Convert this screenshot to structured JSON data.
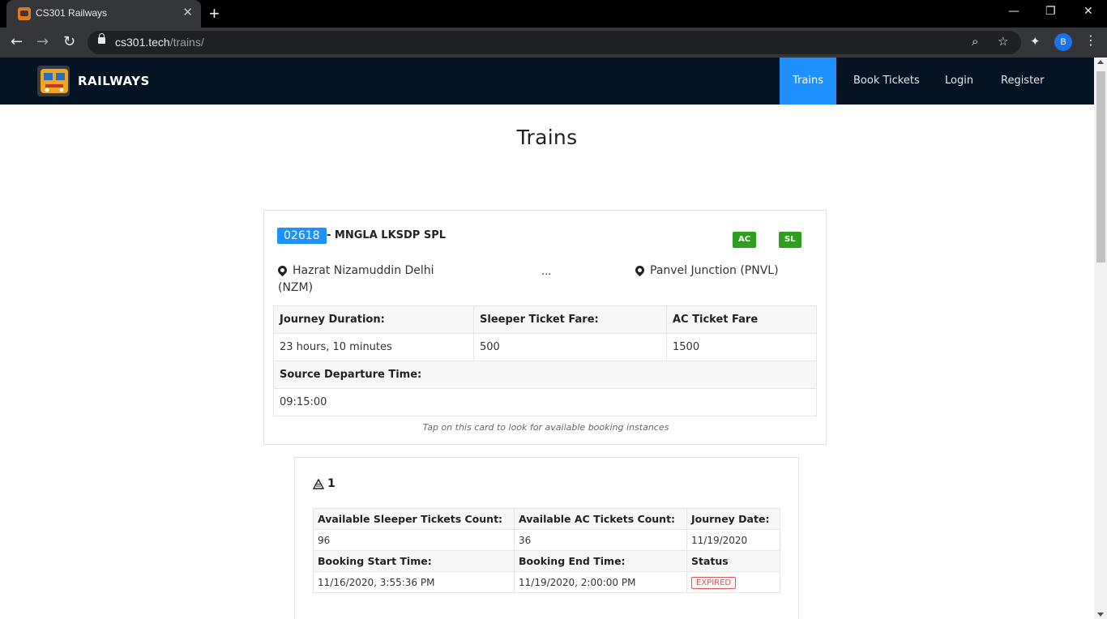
{
  "browser": {
    "tab_title": "CS301 Railways",
    "url_domain": "cs301.tech",
    "url_path": "/trains/",
    "profile_initial": "B"
  },
  "navbar": {
    "brand": "RAILWAYS",
    "links": [
      "Trains",
      "Book Tickets",
      "Login",
      "Register"
    ],
    "active": "Trains"
  },
  "page": {
    "title": "Trains"
  },
  "train": {
    "number": "02618",
    "name": "- MNGLA LKSDP SPL",
    "classes": [
      "AC",
      "SL"
    ],
    "source": "Hazrat Nizamuddin Delhi (NZM)",
    "source_line1": "Hazrat Nizamuddin Delhi",
    "source_line2": "(NZM)",
    "separator": "...",
    "destination": "Panvel Junction (PNVL)",
    "labels": {
      "duration": "Journey Duration:",
      "sleeper_fare": "Sleeper Ticket Fare:",
      "ac_fare": "AC Ticket Fare",
      "departure": "Source Departure Time:"
    },
    "duration": "23 hours, 10 minutes",
    "sleeper_fare": "500",
    "ac_fare": "1500",
    "departure_time": "09:15:00",
    "hint": "Tap on this card to look for available booking instances"
  },
  "instance": {
    "id": "1",
    "labels": {
      "sleeper_count": "Available Sleeper Tickets Count:",
      "ac_count": "Available AC Tickets Count:",
      "journey_date": "Journey Date:",
      "booking_start": "Booking Start Time:",
      "booking_end": "Booking End Time:",
      "status": "Status"
    },
    "sleeper_count": "96",
    "ac_count": "36",
    "journey_date": "11/19/2020",
    "booking_start": "11/16/2020, 3:55:36 PM",
    "booking_end": "11/19/2020, 2:00:00 PM",
    "status": "EXPIRED"
  },
  "colors": {
    "navbar_bg": "#051425",
    "accent": "#1e90ff",
    "badge_green": "#2e9e1f",
    "expired_red": "#e05555"
  },
  "icons": [
    "back-arrow-icon",
    "forward-arrow-icon",
    "reload-icon",
    "lock-icon",
    "zoom-icon",
    "star-icon",
    "extensions-icon",
    "menu-icon",
    "location-pin-icon",
    "instance-icon"
  ]
}
